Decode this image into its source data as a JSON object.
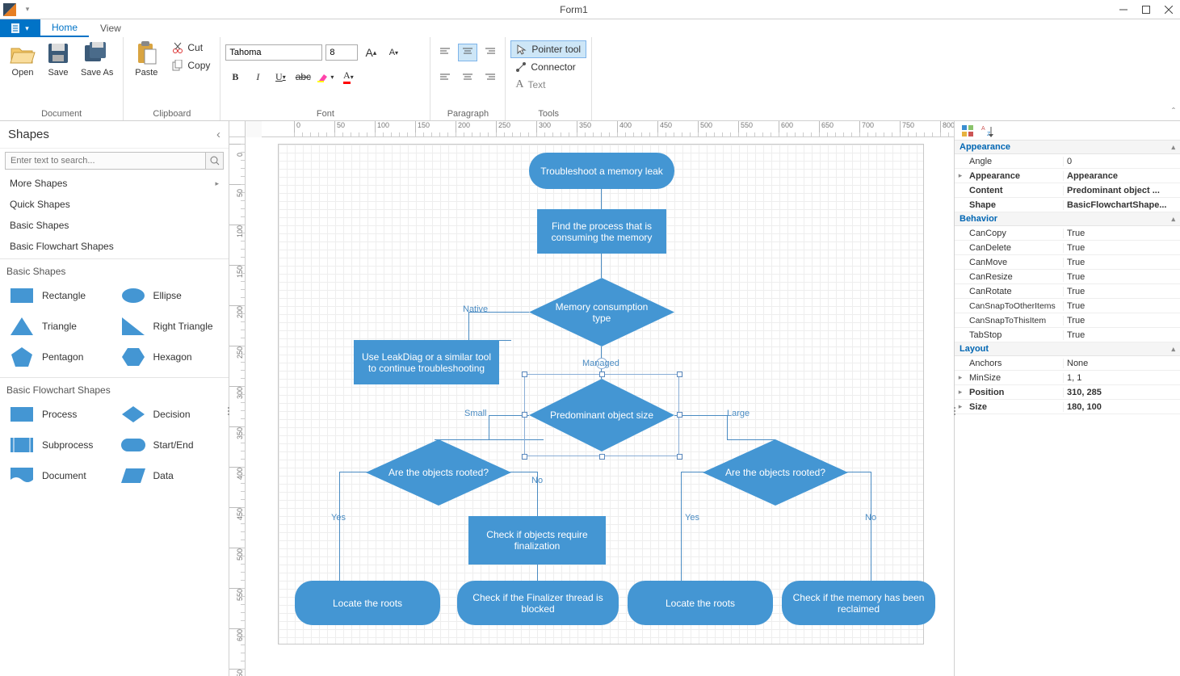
{
  "window": {
    "title": "Form1"
  },
  "tabs": {
    "home": "Home",
    "view": "View"
  },
  "ribbon": {
    "open": "Open",
    "save": "Save",
    "saveas": "Save As",
    "paste": "Paste",
    "cut": "Cut",
    "copy": "Copy",
    "document": "Document",
    "clipboard": "Clipboard",
    "font_name": "Tahoma",
    "font_size": "8",
    "font": "Font",
    "paragraph": "Paragraph",
    "pointer": "Pointer tool",
    "connector": "Connector",
    "text": "Text",
    "tools": "Tools"
  },
  "shapes": {
    "title": "Shapes",
    "search_placeholder": "Enter text to search...",
    "cat_more": "More Shapes",
    "cat_quick": "Quick Shapes",
    "cat_basic": "Basic Shapes",
    "cat_flow": "Basic Flowchart Shapes",
    "sec_basic": "Basic Shapes",
    "rectangle": "Rectangle",
    "ellipse": "Ellipse",
    "triangle": "Triangle",
    "rtriangle": "Right Triangle",
    "pentagon": "Pentagon",
    "hexagon": "Hexagon",
    "sec_flow": "Basic Flowchart Shapes",
    "process": "Process",
    "decision": "Decision",
    "subprocess": "Subprocess",
    "startend": "Start/End",
    "document_s": "Document",
    "data": "Data"
  },
  "diagram": {
    "n1": "Troubleshoot a memory leak",
    "n2": "Find the process that is consuming the memory",
    "n3": "Memory consumption type",
    "n4": "Use LeakDiag or a similar tool to continue troubleshooting",
    "n5": "Predominant object size",
    "n6": "Are the objects rooted?",
    "n7": "Are the objects rooted?",
    "n8": "Check if objects require finalization",
    "n9": "Locate the roots",
    "n10": "Check if the Finalizer thread is blocked",
    "n11": "Locate the roots",
    "n12": "Check if the memory has been reclaimed",
    "l_native": "Native",
    "l_managed": "Managed",
    "l_small": "Small",
    "l_large": "Large",
    "l_yes": "Yes",
    "l_no": "No"
  },
  "props": {
    "cat_appearance": "Appearance",
    "angle": "Angle",
    "angle_v": "0",
    "appearance": "Appearance",
    "appearance_v": "Appearance",
    "content": "Content",
    "content_v": "Predominant object ...",
    "shape": "Shape",
    "shape_v": "BasicFlowchartShape...",
    "cat_behavior": "Behavior",
    "cancopy": "CanCopy",
    "candelete": "CanDelete",
    "canmove": "CanMove",
    "canresize": "CanResize",
    "canrotate": "CanRotate",
    "cansnapother": "CanSnapToOtherItems",
    "cansnapthis": "CanSnapToThisItem",
    "tabstop": "TabStop",
    "true": "True",
    "cat_layout": "Layout",
    "anchors": "Anchors",
    "anchors_v": "None",
    "minsize": "MinSize",
    "minsize_v": "1, 1",
    "position": "Position",
    "position_v": "310, 285",
    "size": "Size",
    "size_v": "180, 100"
  }
}
